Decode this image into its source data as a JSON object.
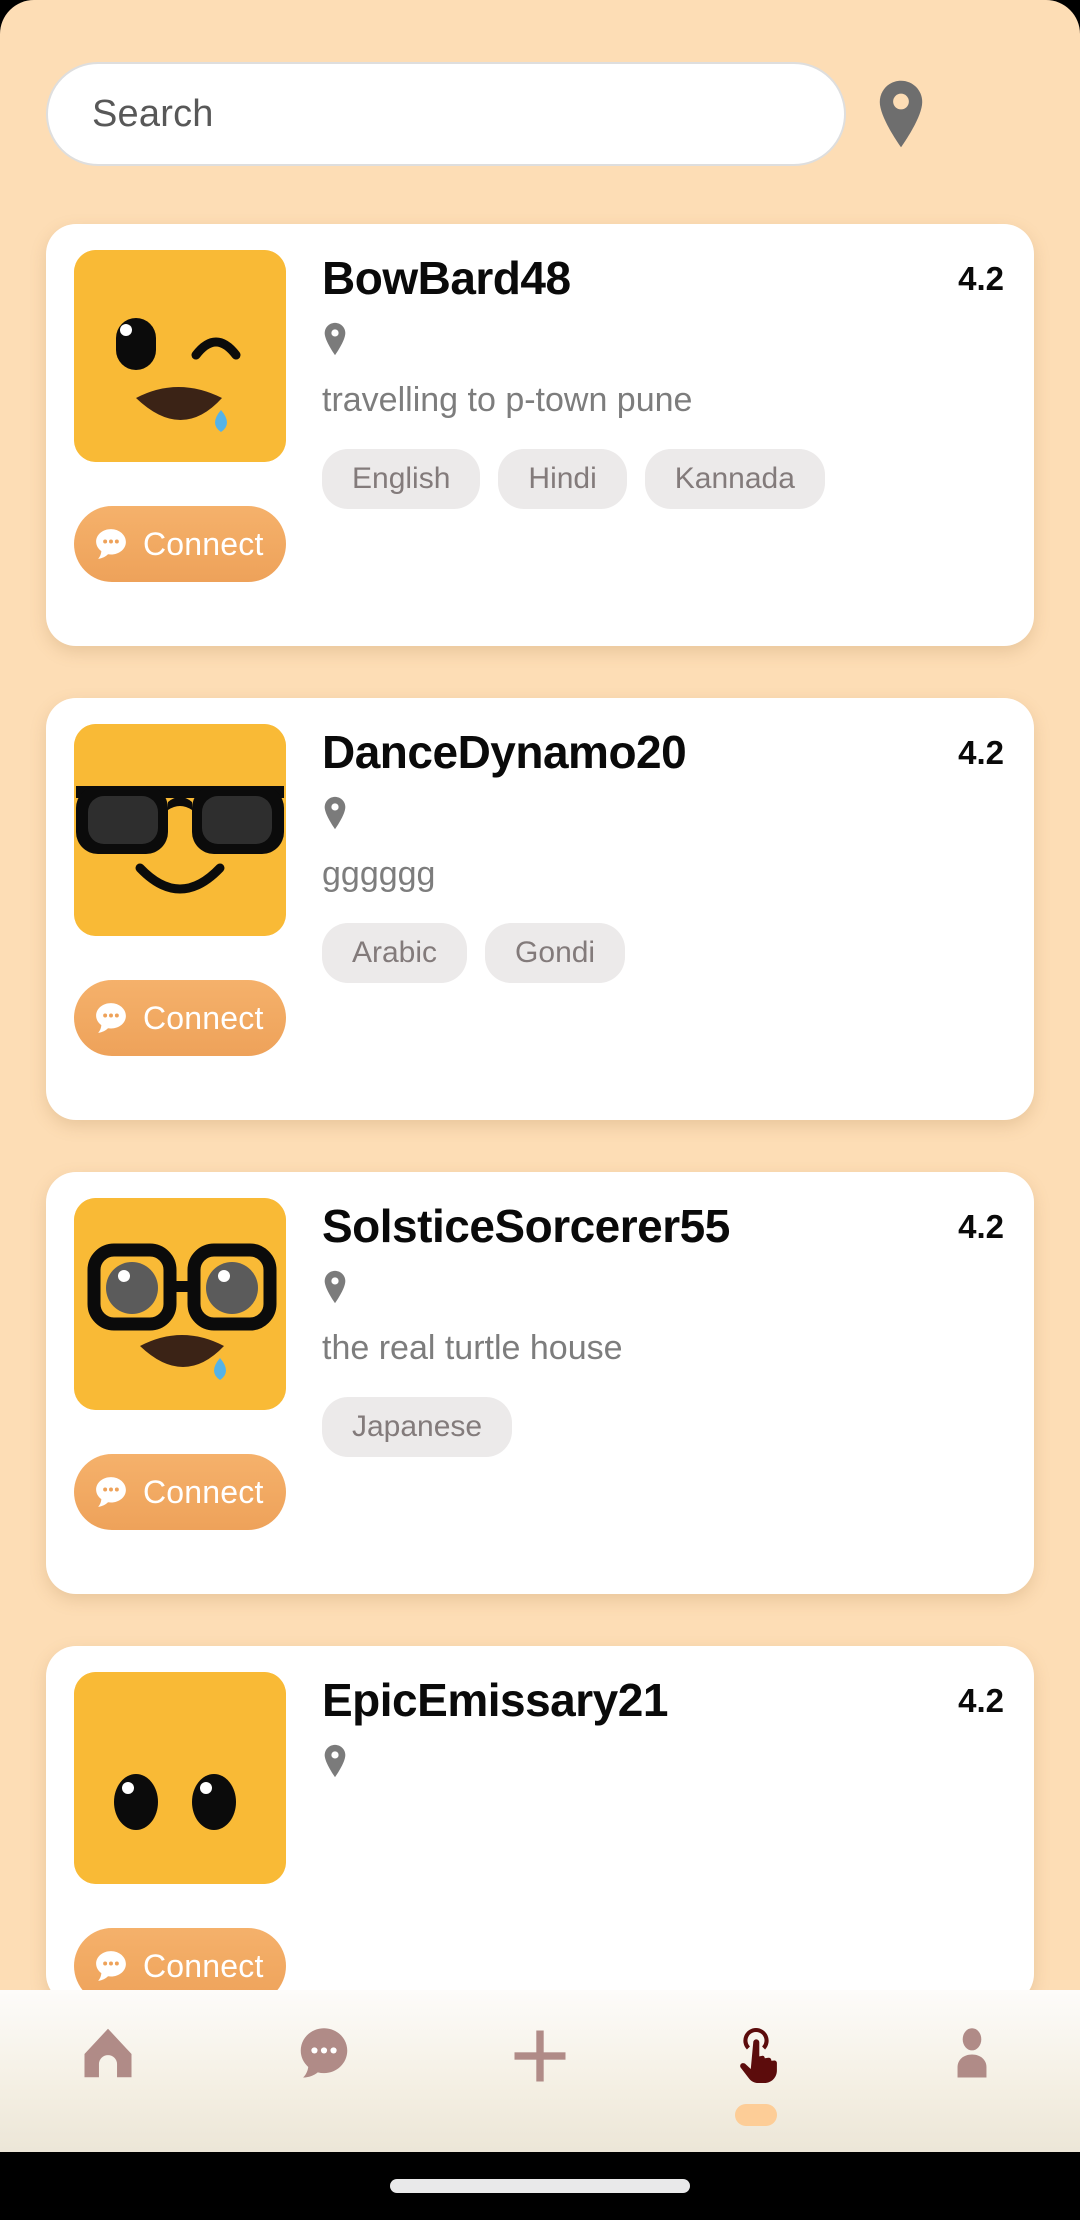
{
  "theme": {
    "background": "#fdddb5",
    "card_background": "#ffffff",
    "avatar_background": "#f9ba36",
    "connect_button": "#eea25a",
    "chip_background": "#eceaea",
    "active_nav": "#5c0c0c",
    "inactive_nav": "#b08b87",
    "nav_indicator": "#fdcd97"
  },
  "search": {
    "placeholder": "Search",
    "value": "",
    "location_icon": "location-pin-icon"
  },
  "cards": [
    {
      "username": "BowBard48",
      "rating": "4.2",
      "location": "",
      "status": "travelling to p-town pune",
      "languages": [
        "English",
        "Hindi",
        "Kannada"
      ],
      "connect_label": "Connect",
      "avatar": "winking-crying-face"
    },
    {
      "username": "DanceDynamo20",
      "rating": "4.2",
      "location": "",
      "status": "gggggg",
      "languages": [
        "Arabic",
        "Gondi"
      ],
      "connect_label": "Connect",
      "avatar": "sunglasses-smiling-face"
    },
    {
      "username": "SolsticeSorcerer55",
      "rating": "4.2",
      "location": "",
      "status": "the real turtle house",
      "languages": [
        "Japanese"
      ],
      "connect_label": "Connect",
      "avatar": "nerd-glasses-crying-face"
    },
    {
      "username": "EpicEmissary21",
      "rating": "4.2",
      "location": "",
      "status": "",
      "languages": [],
      "connect_label": "Connect",
      "avatar": "wide-eyes-face"
    }
  ],
  "bottom_nav": {
    "items": [
      {
        "name": "home",
        "icon": "home-icon",
        "active": false
      },
      {
        "name": "chats",
        "icon": "chat-bubble-icon",
        "active": false
      },
      {
        "name": "add",
        "icon": "plus-icon",
        "active": false
      },
      {
        "name": "discover",
        "icon": "tap-hand-icon",
        "active": true
      },
      {
        "name": "profile",
        "icon": "person-icon",
        "active": false
      }
    ]
  }
}
